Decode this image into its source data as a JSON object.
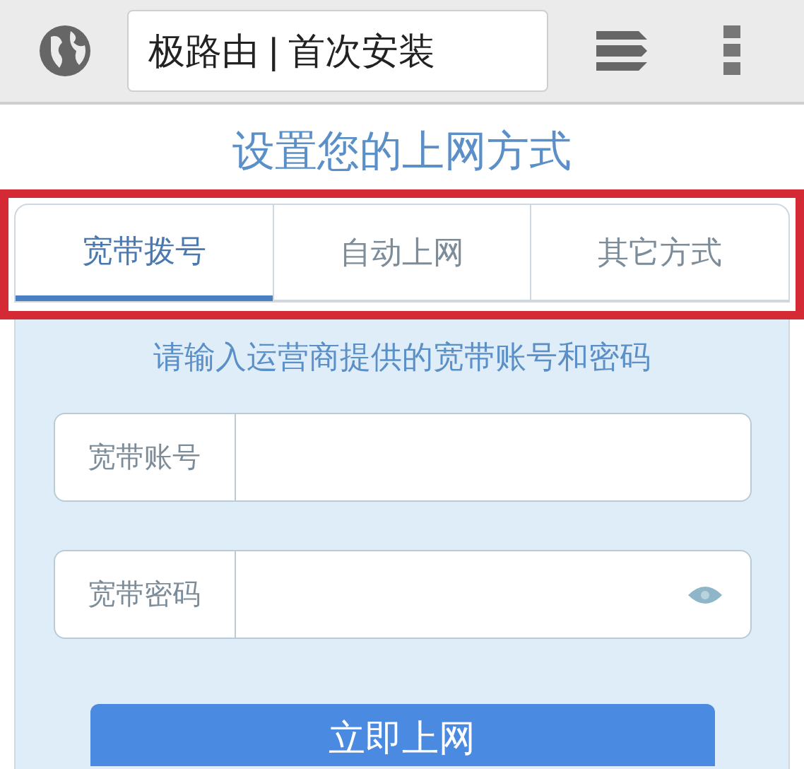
{
  "browser": {
    "address": "极路由 | 首次安装"
  },
  "title": "设置您的上网方式",
  "tabs": [
    {
      "label": "宽带拨号",
      "selected": true
    },
    {
      "label": "自动上网",
      "selected": false
    },
    {
      "label": "其它方式",
      "selected": false
    }
  ],
  "instruction": "请输入运营商提供的宽带账号和密码",
  "fields": [
    {
      "kind": "text",
      "label": "宽带账号"
    },
    {
      "kind": "password",
      "label": "宽带密码"
    }
  ],
  "submit": "立即上网"
}
